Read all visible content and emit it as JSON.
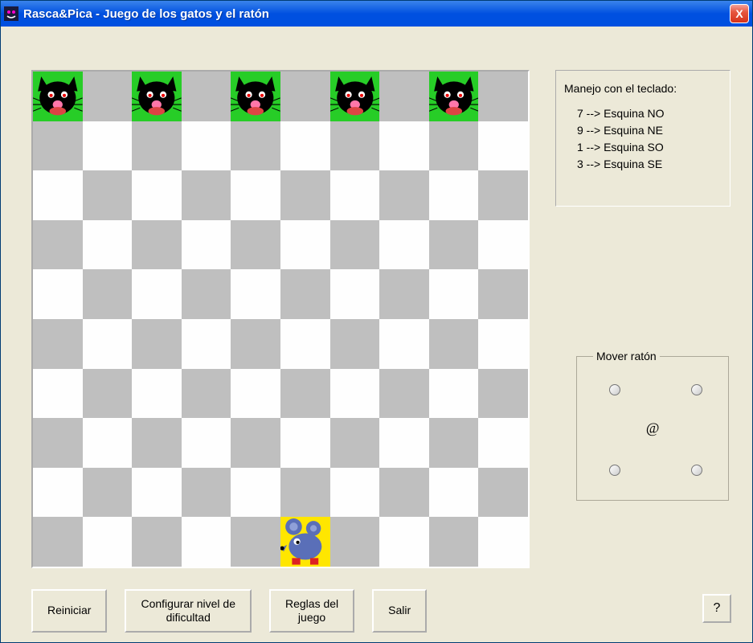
{
  "window": {
    "title": "Rasca&Pica - Juego de los gatos y el ratón"
  },
  "board": {
    "size": 10,
    "cats": [
      {
        "row": 0,
        "col": 0
      },
      {
        "row": 0,
        "col": 2
      },
      {
        "row": 0,
        "col": 4
      },
      {
        "row": 0,
        "col": 6
      },
      {
        "row": 0,
        "col": 8
      }
    ],
    "mouse": {
      "row": 9,
      "col": 5
    }
  },
  "keyboard_help": {
    "title": "Manejo con el teclado:",
    "lines": [
      "7 --> Esquina NO",
      "9 --> Esquina NE",
      "1 --> Esquina SO",
      "3 --> Esquina SE"
    ]
  },
  "move_group": {
    "legend": "Mover ratón",
    "center": "@"
  },
  "buttons": {
    "restart": "Reiniciar",
    "configure": "Configurar nivel de\ndificultad",
    "rules": "Reglas del\njuego",
    "exit": "Salir",
    "help": "?"
  },
  "close_label": "X"
}
